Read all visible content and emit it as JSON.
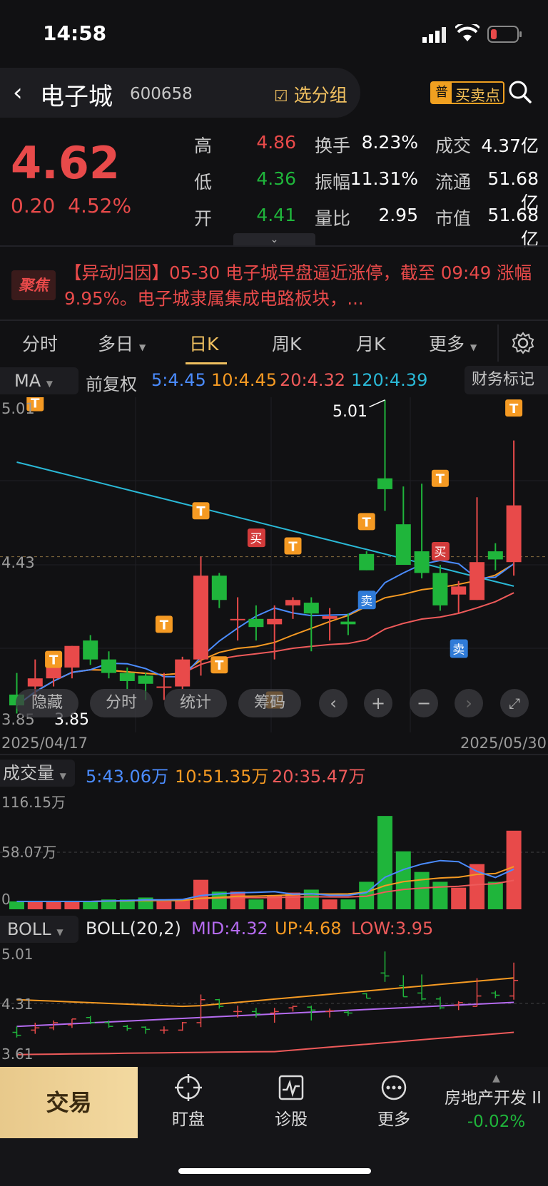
{
  "status": {
    "time": "14:58"
  },
  "header": {
    "stock_name": "电子城",
    "stock_code": "600658",
    "group_btn": "选分组",
    "buysell_badge": "普",
    "buysell_btn": "买卖点"
  },
  "quote": {
    "price": "4.62",
    "change": "0.20",
    "change_pct": "4.52%",
    "high_label": "高",
    "high": "4.86",
    "low_label": "低",
    "low": "4.36",
    "open_label": "开",
    "open": "4.41",
    "turnover_label": "换手",
    "turnover": "8.23%",
    "amplitude_label": "振幅",
    "amplitude": "11.31%",
    "vol_ratio_label": "量比",
    "vol_ratio": "2.95",
    "amount_label": "成交",
    "amount": "4.37亿",
    "float_label": "流通",
    "float_cap": "51.68亿",
    "mcap_label": "市值",
    "mcap": "51.68亿"
  },
  "news": {
    "badge": "聚焦",
    "text": "【异动归因】05-30 电子城早盘逼近涨停，截至 09:49 涨幅9.95%。电子城隶属集成电路板块，..."
  },
  "tabs": [
    {
      "label": "分时"
    },
    {
      "label": "多日"
    },
    {
      "label": "日K"
    },
    {
      "label": "周K"
    },
    {
      "label": "月K"
    },
    {
      "label": "更多"
    }
  ],
  "ma_bar": {
    "indicator": "MA",
    "adjust": "前复权",
    "ma5": "5:4.45",
    "ma10": "10:4.45",
    "ma20": "20:4.32",
    "ma120": "120:4.39",
    "fin_mark": "财务标记"
  },
  "kline": {
    "y_top": "5.01",
    "y_mid": "4.43",
    "y_bot": "3.85",
    "max_label": "5.01",
    "min_label": "3.85",
    "date_start": "2025/04/17",
    "date_end": "2025/05/30",
    "marker_t": "T",
    "marker_buy": "买",
    "marker_sell": "卖"
  },
  "overlay": {
    "hide": "隐藏",
    "intraday": "分时",
    "stats": "统计",
    "chips": "筹码"
  },
  "volume": {
    "label": "成交量",
    "ma5": "5:43.06万",
    "ma10": "10:51.35万",
    "ma20": "20:35.47万",
    "y_top": "116.15万",
    "y_mid": "58.07万",
    "y_bot": "0"
  },
  "boll": {
    "label": "BOLL",
    "params": "BOLL(20,2)",
    "mid": "MID:4.32",
    "up": "UP:4.68",
    "low": "LOW:3.95",
    "y_top": "5.01",
    "y_mid": "4.31",
    "y_bot": "3.61"
  },
  "bottom_nav": {
    "trade": "交易",
    "watch": "盯盘",
    "diagnose": "诊股",
    "more": "更多",
    "sector_name": "房地产开发 II",
    "sector_chg": "-0.02%"
  },
  "chart_data": {
    "type": "candlestick",
    "dates_shown": [
      "2025/04/17",
      "2025/05/30"
    ],
    "candles": [
      {
        "o": 3.92,
        "h": 4.0,
        "l": 3.85,
        "c": 3.88
      },
      {
        "o": 3.95,
        "h": 4.05,
        "l": 3.9,
        "c": 3.98
      },
      {
        "o": 3.98,
        "h": 4.08,
        "l": 3.95,
        "c": 4.05
      },
      {
        "o": 4.02,
        "h": 4.1,
        "l": 3.98,
        "c": 4.1
      },
      {
        "o": 4.12,
        "h": 4.14,
        "l": 4.03,
        "c": 4.05
      },
      {
        "o": 4.05,
        "h": 4.08,
        "l": 3.98,
        "c": 4.0
      },
      {
        "o": 4.0,
        "h": 4.02,
        "l": 3.94,
        "c": 3.97
      },
      {
        "o": 3.99,
        "h": 4.0,
        "l": 3.9,
        "c": 3.96
      },
      {
        "o": 3.95,
        "h": 4.0,
        "l": 3.9,
        "c": 3.95
      },
      {
        "o": 3.95,
        "h": 4.06,
        "l": 3.94,
        "c": 4.05
      },
      {
        "o": 4.05,
        "h": 4.43,
        "l": 3.99,
        "c": 4.36
      },
      {
        "o": 4.36,
        "h": 4.37,
        "l": 4.24,
        "c": 4.27
      },
      {
        "o": 4.2,
        "h": 4.28,
        "l": 4.12,
        "c": 4.2
      },
      {
        "o": 4.2,
        "h": 4.25,
        "l": 4.12,
        "c": 4.17
      },
      {
        "o": 4.18,
        "h": 4.25,
        "l": 4.05,
        "c": 4.2
      },
      {
        "o": 4.25,
        "h": 4.28,
        "l": 4.2,
        "c": 4.27
      },
      {
        "o": 4.26,
        "h": 4.28,
        "l": 4.08,
        "c": 4.22
      },
      {
        "o": 4.2,
        "h": 4.24,
        "l": 4.12,
        "c": 4.21
      },
      {
        "o": 4.19,
        "h": 4.22,
        "l": 4.14,
        "c": 4.18
      },
      {
        "o": 4.44,
        "h": 4.45,
        "l": 4.38,
        "c": 4.38
      },
      {
        "o": 4.72,
        "h": 5.01,
        "l": 4.6,
        "c": 4.68
      },
      {
        "o": 4.55,
        "h": 4.69,
        "l": 4.4,
        "c": 4.4
      },
      {
        "o": 4.45,
        "h": 4.7,
        "l": 4.35,
        "c": 4.37
      },
      {
        "o": 4.37,
        "h": 4.4,
        "l": 4.23,
        "c": 4.25
      },
      {
        "o": 4.29,
        "h": 4.34,
        "l": 4.22,
        "c": 4.32
      },
      {
        "o": 4.27,
        "h": 4.65,
        "l": 4.27,
        "c": 4.41
      },
      {
        "o": 4.45,
        "h": 4.48,
        "l": 4.38,
        "c": 4.42
      },
      {
        "o": 4.41,
        "h": 4.86,
        "l": 4.36,
        "c": 4.62
      }
    ],
    "volume": [
      8,
      8,
      8,
      8,
      8,
      10,
      10,
      12,
      8,
      10,
      30,
      18,
      18,
      10,
      14,
      17,
      20,
      10,
      10,
      28,
      95,
      59,
      38,
      28,
      22,
      46,
      28,
      80
    ],
    "volume_ylim": [
      0,
      116.15
    ]
  }
}
